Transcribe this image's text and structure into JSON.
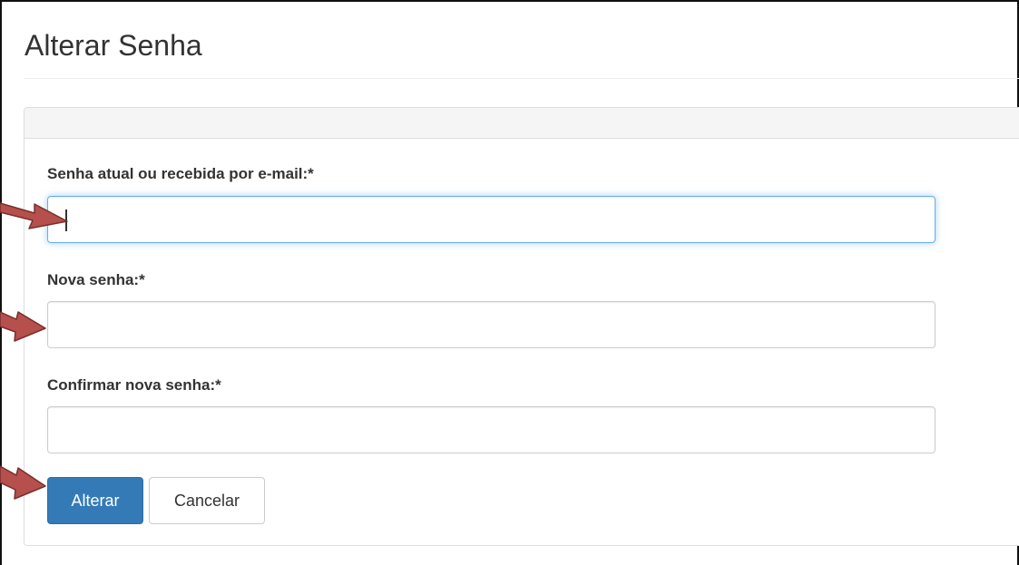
{
  "page": {
    "title": "Alterar Senha"
  },
  "form": {
    "current_password": {
      "label": "Senha atual ou recebida por e-mail:*",
      "value": ""
    },
    "new_password": {
      "label": "Nova senha:*",
      "value": ""
    },
    "confirm_password": {
      "label": "Confirmar nova senha:*",
      "value": ""
    }
  },
  "actions": {
    "submit_label": "Alterar",
    "cancel_label": "Cancelar"
  },
  "colors": {
    "primary": "#337ab7",
    "focus_border": "#66afe9",
    "annotation_arrow": "#b5504d"
  },
  "annotations": {
    "arrow_icon": "red-arrow-icon"
  }
}
